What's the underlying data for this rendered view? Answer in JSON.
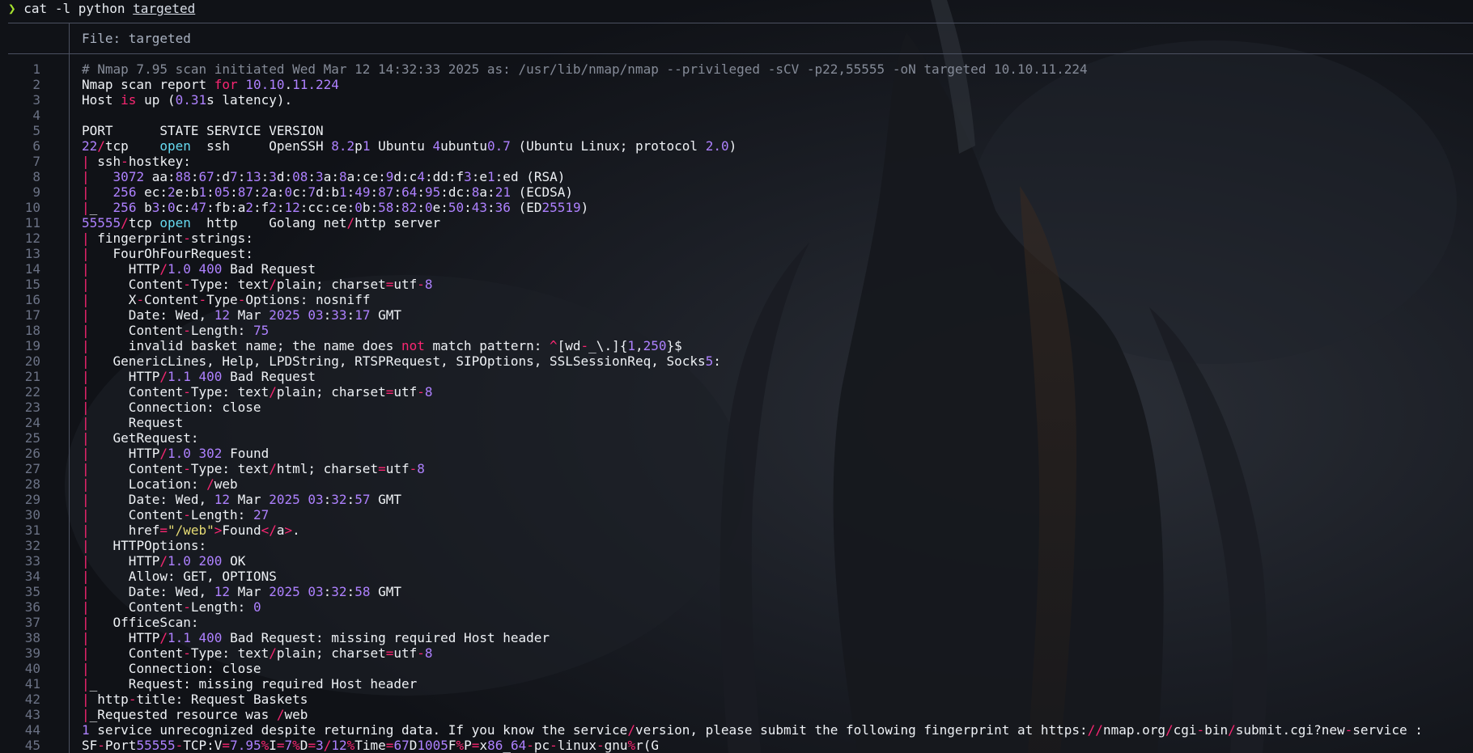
{
  "prompt": {
    "symbol": "❯",
    "command": "cat",
    "flag": "-l",
    "lang": "python",
    "argument": "targeted"
  },
  "file_header": {
    "label": "File: targeted"
  },
  "lines": [
    {
      "n": "1",
      "text": "# Nmap 7.95 scan initiated Wed Mar 12 14:32:33 2025 as: /usr/lib/nmap/nmap --privileged -sCV -p22,55555 -oN targeted 10.10.11.224"
    },
    {
      "n": "2",
      "text": "Nmap scan report for 10.10.11.224"
    },
    {
      "n": "3",
      "text": "Host is up (0.31s latency)."
    },
    {
      "n": "4",
      "text": ""
    },
    {
      "n": "5",
      "text": "PORT      STATE SERVICE VERSION"
    },
    {
      "n": "6",
      "text": "22/tcp    open  ssh     OpenSSH 8.2p1 Ubuntu 4ubuntu0.7 (Ubuntu Linux; protocol 2.0)"
    },
    {
      "n": "7",
      "text": "| ssh-hostkey:"
    },
    {
      "n": "8",
      "text": "|   3072 aa:88:67:d7:13:3d:08:3a:8a:ce:9d:c4:dd:f3:e1:ed (RSA)"
    },
    {
      "n": "9",
      "text": "|   256 ec:2e:b1:05:87:2a:0c:7d:b1:49:87:64:95:dc:8a:21 (ECDSA)"
    },
    {
      "n": "10",
      "text": "|_  256 b3:0c:47:fb:a2:f2:12:cc:ce:0b:58:82:0e:50:43:36 (ED25519)"
    },
    {
      "n": "11",
      "text": "55555/tcp open  http    Golang net/http server"
    },
    {
      "n": "12",
      "text": "| fingerprint-strings:"
    },
    {
      "n": "13",
      "text": "|   FourOhFourRequest:"
    },
    {
      "n": "14",
      "text": "|     HTTP/1.0 400 Bad Request"
    },
    {
      "n": "15",
      "text": "|     Content-Type: text/plain; charset=utf-8"
    },
    {
      "n": "16",
      "text": "|     X-Content-Type-Options: nosniff"
    },
    {
      "n": "17",
      "text": "|     Date: Wed, 12 Mar 2025 03:33:17 GMT"
    },
    {
      "n": "18",
      "text": "|     Content-Length: 75"
    },
    {
      "n": "19",
      "text": "|     invalid basket name; the name does not match pattern: ^[wd-_\\.]{1,250}$"
    },
    {
      "n": "20",
      "text": "|   GenericLines, Help, LPDString, RTSPRequest, SIPOptions, SSLSessionReq, Socks5:"
    },
    {
      "n": "21",
      "text": "|     HTTP/1.1 400 Bad Request"
    },
    {
      "n": "22",
      "text": "|     Content-Type: text/plain; charset=utf-8"
    },
    {
      "n": "23",
      "text": "|     Connection: close"
    },
    {
      "n": "24",
      "text": "|     Request"
    },
    {
      "n": "25",
      "text": "|   GetRequest:"
    },
    {
      "n": "26",
      "text": "|     HTTP/1.0 302 Found"
    },
    {
      "n": "27",
      "text": "|     Content-Type: text/html; charset=utf-8"
    },
    {
      "n": "28",
      "text": "|     Location: /web"
    },
    {
      "n": "29",
      "text": "|     Date: Wed, 12 Mar 2025 03:32:57 GMT"
    },
    {
      "n": "30",
      "text": "|     Content-Length: 27"
    },
    {
      "n": "31",
      "text": "|     href=\"/web\">Found</a>."
    },
    {
      "n": "32",
      "text": "|   HTTPOptions:"
    },
    {
      "n": "33",
      "text": "|     HTTP/1.0 200 OK"
    },
    {
      "n": "34",
      "text": "|     Allow: GET, OPTIONS"
    },
    {
      "n": "35",
      "text": "|     Date: Wed, 12 Mar 2025 03:32:58 GMT"
    },
    {
      "n": "36",
      "text": "|     Content-Length: 0"
    },
    {
      "n": "37",
      "text": "|   OfficeScan:"
    },
    {
      "n": "38",
      "text": "|     HTTP/1.1 400 Bad Request: missing required Host header"
    },
    {
      "n": "39",
      "text": "|     Content-Type: text/plain; charset=utf-8"
    },
    {
      "n": "40",
      "text": "|     Connection: close"
    },
    {
      "n": "41",
      "text": "|_    Request: missing required Host header"
    },
    {
      "n": "42",
      "text": "| http-title: Request Baskets"
    },
    {
      "n": "43",
      "text": "|_Requested resource was /web"
    },
    {
      "n": "44",
      "text": "1 service unrecognized despite returning data. If you know the service/version, please submit the following fingerprint at https://nmap.org/cgi-bin/submit.cgi?new-service :"
    },
    {
      "n": "45",
      "text": "SF-Port55555-TCP:V=7.95%I=7%D=3/12%Time=67D1005F%P=x86_64-pc-linux-gnu%r(G"
    }
  ]
}
